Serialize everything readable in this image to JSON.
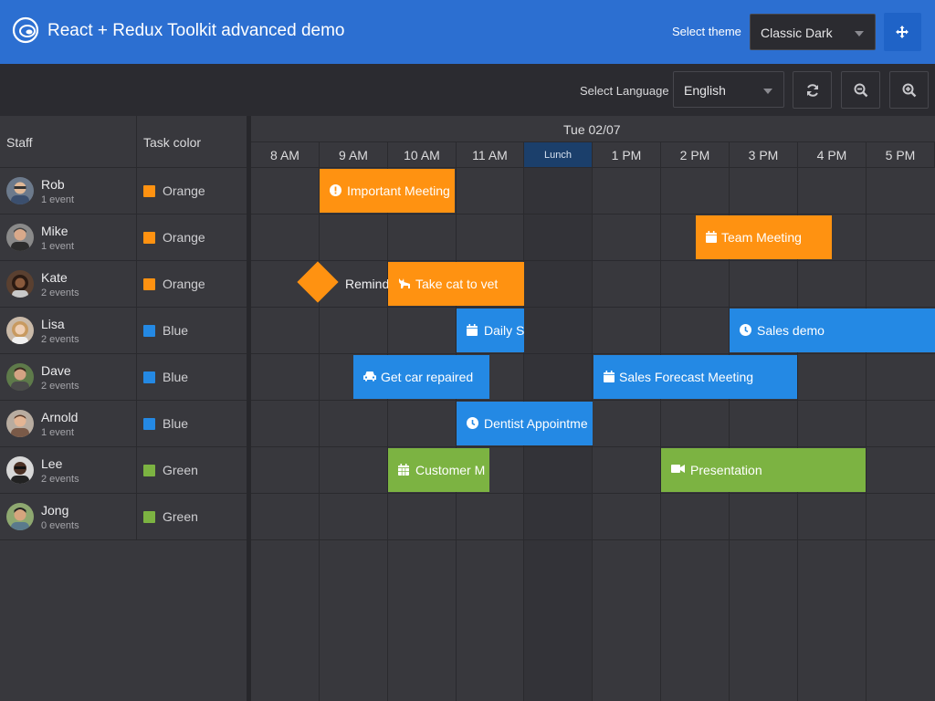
{
  "header": {
    "title": "React + Redux Toolkit advanced demo",
    "theme_label": "Select theme",
    "theme_value": "Classic Dark"
  },
  "toolbar": {
    "language_label": "Select Language",
    "language_value": "English"
  },
  "grid": {
    "staff_header": "Staff",
    "color_header": "Task color",
    "rows": [
      {
        "name": "Rob",
        "count": "1 event",
        "color": "Orange",
        "hex": "#ff9211"
      },
      {
        "name": "Mike",
        "count": "1 event",
        "color": "Orange",
        "hex": "#ff9211"
      },
      {
        "name": "Kate",
        "count": "2 events",
        "color": "Orange",
        "hex": "#ff9211"
      },
      {
        "name": "Lisa",
        "count": "2 events",
        "color": "Blue",
        "hex": "#2489e4"
      },
      {
        "name": "Dave",
        "count": "2 events",
        "color": "Blue",
        "hex": "#2489e4"
      },
      {
        "name": "Arnold",
        "count": "1 event",
        "color": "Blue",
        "hex": "#2489e4"
      },
      {
        "name": "Lee",
        "count": "2 events",
        "color": "Green",
        "hex": "#7cb342"
      },
      {
        "name": "Jong",
        "count": "0 events",
        "color": "Green",
        "hex": "#7cb342"
      }
    ]
  },
  "schedule": {
    "date": "Tue 02/07",
    "hours": [
      "8 AM",
      "9 AM",
      "10 AM",
      "11 AM",
      "Lunch",
      "1 PM",
      "2 PM",
      "3 PM",
      "4 PM",
      "5 PM"
    ],
    "events": {
      "rob_1": "Important Meeting",
      "mike_1": "Team Meeting",
      "kate_milestone": "Remind",
      "kate_1": "Take cat to vet",
      "lisa_1": "Daily S",
      "lisa_2": "Sales demo",
      "dave_1": "Get car repaired",
      "dave_2": "Sales Forecast Meeting",
      "arnold_1": "Dentist Appointme",
      "lee_1": "Customer M",
      "lee_2": "Presentation"
    }
  },
  "colors": {
    "header": "#2c6fd1",
    "orange": "#ff9211",
    "blue": "#2489e4",
    "green": "#7cb342"
  }
}
